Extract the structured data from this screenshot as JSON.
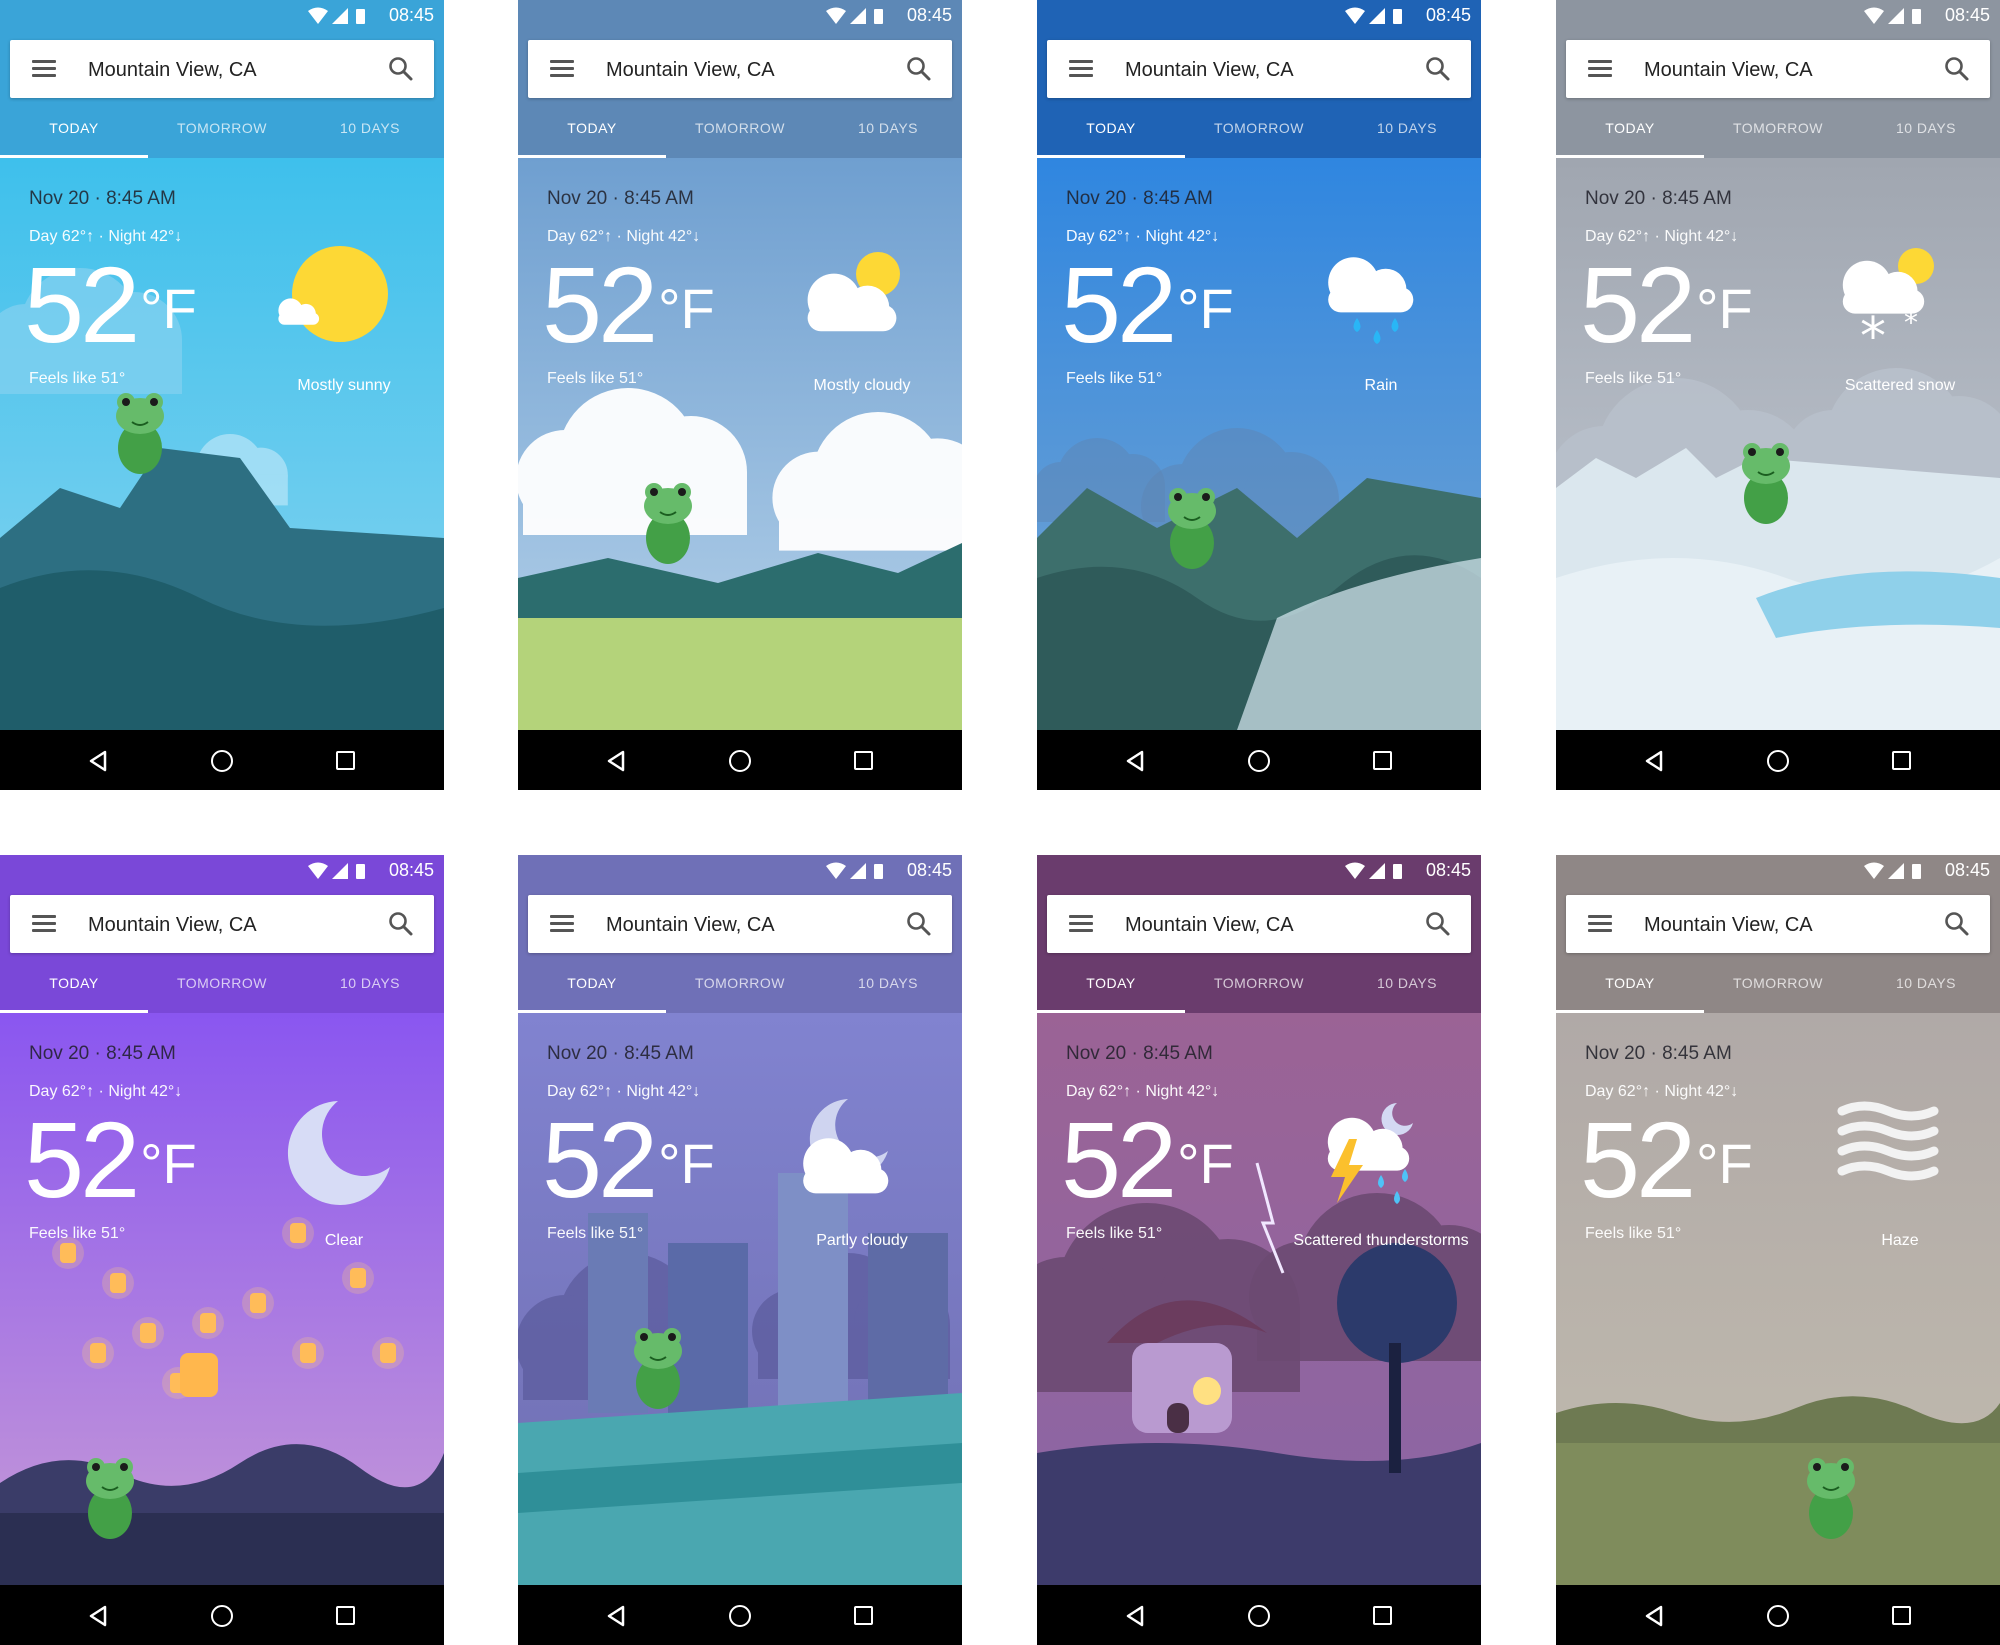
{
  "status": {
    "time": "08:45"
  },
  "search": {
    "location": "Mountain View, CA"
  },
  "tabs": [
    "TODAY",
    "TOMORROW",
    "10 DAYS"
  ],
  "weather": {
    "date": "Nov 20 · 8:45 AM",
    "day_night": "Day 62°↑ · Night 42°↓",
    "temp": "52",
    "unit": "°F",
    "feels_like": "Feels like 51°"
  },
  "screens": [
    {
      "condition": "Mostly sunny",
      "icon": "mostly-sunny-icon",
      "colors": {
        "bar": "#3aa4d8",
        "sky_top": "#3ec0ec",
        "sky_bottom": "#88d4ef",
        "ground": "#2f7d8c"
      }
    },
    {
      "condition": "Mostly cloudy",
      "icon": "mostly-cloudy-icon",
      "colors": {
        "bar": "#5d88b6",
        "sky_top": "#6f9fd0",
        "sky_bottom": "#b7d3ea",
        "ground": "#b4d37a"
      }
    },
    {
      "condition": "Rain",
      "icon": "rain-icon",
      "colors": {
        "bar": "#1f63b5",
        "sky_top": "#2f86e0",
        "sky_bottom": "#7aa7d0",
        "ground": "#2f5b5a"
      }
    },
    {
      "condition": "Scattered snow",
      "icon": "snow-icon",
      "colors": {
        "bar": "#8d95a0",
        "sky_top": "#a0a6b0",
        "sky_bottom": "#c5ccd6",
        "ground": "#e8f1f6"
      }
    },
    {
      "condition": "Clear",
      "icon": "moon-icon",
      "colors": {
        "bar": "#7a48d8",
        "sky_top": "#8a56f0",
        "sky_bottom": "#c79bd6",
        "ground": "#2b2f52"
      }
    },
    {
      "condition": "Partly cloudy",
      "icon": "partly-cloudy-night-icon",
      "colors": {
        "bar": "#6f70b7",
        "sky_top": "#8183d0",
        "sky_bottom": "#6f6eb0",
        "ground": "#4aa7b0"
      }
    },
    {
      "condition": "Scattered thunderstorms",
      "icon": "thunderstorm-icon",
      "colors": {
        "bar": "#6a3c6d",
        "sky_top": "#9b6395",
        "sky_bottom": "#8a66a6",
        "ground": "#3d3b6b"
      }
    },
    {
      "condition": "Haze",
      "icon": "haze-icon",
      "colors": {
        "bar": "#8f8786",
        "sky_top": "#b0a9a7",
        "sky_bottom": "#c2bcae",
        "ground": "#7f8c5c"
      }
    }
  ]
}
